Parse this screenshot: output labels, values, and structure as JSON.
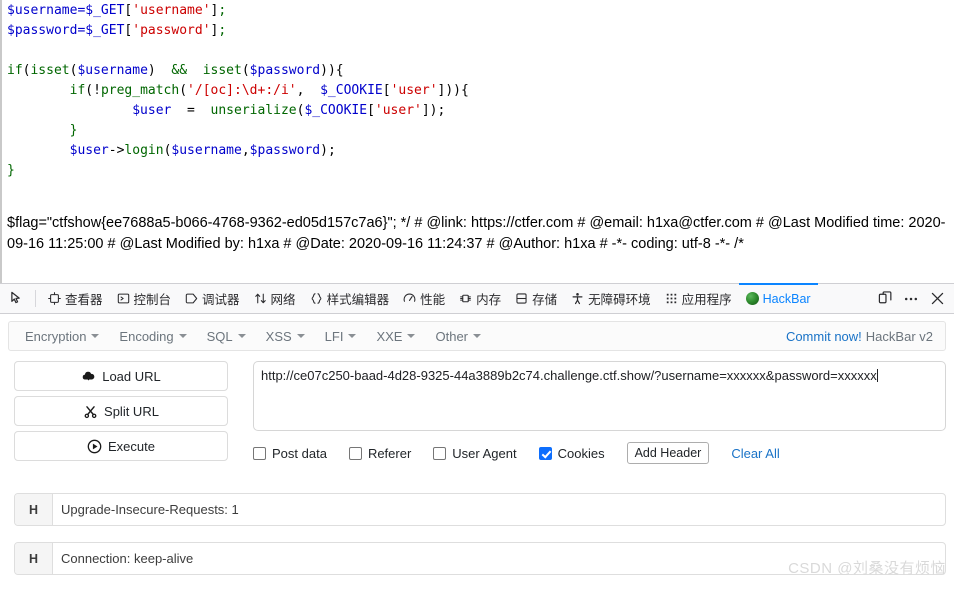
{
  "page": {
    "code_lines": [
      [
        {
          "t": "$username=",
          "c": "var"
        },
        {
          "t": "$_GET",
          "c": "var"
        },
        {
          "t": "[",
          "c": "punc"
        },
        {
          "t": "'username'",
          "c": "str"
        },
        {
          "t": "]",
          "c": "punc"
        },
        {
          "t": ";",
          "c": "fn"
        }
      ],
      [
        {
          "t": "$password=",
          "c": "var"
        },
        {
          "t": "$_GET",
          "c": "var"
        },
        {
          "t": "[",
          "c": "punc"
        },
        {
          "t": "'password'",
          "c": "str"
        },
        {
          "t": "]",
          "c": "punc"
        },
        {
          "t": ";",
          "c": "fn"
        }
      ],
      [],
      [
        {
          "t": "if",
          "c": "kw"
        },
        {
          "t": "(",
          "c": "punc"
        },
        {
          "t": "isset",
          "c": "fn"
        },
        {
          "t": "(",
          "c": "punc"
        },
        {
          "t": "$username",
          "c": "var"
        },
        {
          "t": ")",
          "c": "punc"
        },
        {
          "t": "  &&  ",
          "c": "fn"
        },
        {
          "t": "isset",
          "c": "fn"
        },
        {
          "t": "(",
          "c": "punc"
        },
        {
          "t": "$password",
          "c": "var"
        },
        {
          "t": ")",
          "c": "punc"
        },
        {
          "t": "){",
          "c": "punc"
        }
      ],
      [
        {
          "t": "        ",
          "c": "punc"
        },
        {
          "t": "if",
          "c": "kw"
        },
        {
          "t": "(!",
          "c": "punc"
        },
        {
          "t": "preg_match",
          "c": "fn"
        },
        {
          "t": "(",
          "c": "punc"
        },
        {
          "t": "'/[oc]:\\d+:/i'",
          "c": "str"
        },
        {
          "t": ",  ",
          "c": "punc"
        },
        {
          "t": "$_COOKIE",
          "c": "var"
        },
        {
          "t": "[",
          "c": "punc"
        },
        {
          "t": "'user'",
          "c": "str"
        },
        {
          "t": "]",
          "c": "punc"
        },
        {
          "t": ")){",
          "c": "punc"
        }
      ],
      [
        {
          "t": "                ",
          "c": "punc"
        },
        {
          "t": "$user",
          "c": "var"
        },
        {
          "t": "  =  ",
          "c": "punc"
        },
        {
          "t": "unserialize",
          "c": "fn"
        },
        {
          "t": "(",
          "c": "punc"
        },
        {
          "t": "$_COOKIE",
          "c": "var"
        },
        {
          "t": "[",
          "c": "punc"
        },
        {
          "t": "'user'",
          "c": "str"
        },
        {
          "t": "]);",
          "c": "punc"
        }
      ],
      [
        {
          "t": "        }",
          "c": "fn"
        }
      ],
      [
        {
          "t": "        ",
          "c": "punc"
        },
        {
          "t": "$user",
          "c": "var"
        },
        {
          "t": "->",
          "c": "punc"
        },
        {
          "t": "login",
          "c": "fn"
        },
        {
          "t": "(",
          "c": "punc"
        },
        {
          "t": "$username",
          "c": "var"
        },
        {
          "t": ",",
          "c": "punc"
        },
        {
          "t": "$password",
          "c": "var"
        },
        {
          "t": ");",
          "c": "punc"
        }
      ],
      [
        {
          "t": "}",
          "c": "fn"
        }
      ]
    ],
    "flag_text": "$flag=\"ctfshow{ee7688a5-b066-4768-9362-ed05d157c7a6}\"; */ # @link: https://ctfer.com # @email: h1xa@ctfer.com # @Last Modified time: 2020-09-16 11:25:00 # @Last Modified by: h1xa # @Date: 2020-09-16 11:24:37 # @Author: h1xa # -*- coding: utf-8 -*- /*"
  },
  "devtools": {
    "tabs": [
      {
        "label": "查看器",
        "icon": "inspector-icon",
        "active": false
      },
      {
        "label": "控制台",
        "icon": "console-icon",
        "active": false
      },
      {
        "label": "调试器",
        "icon": "debugger-icon",
        "active": false
      },
      {
        "label": "网络",
        "icon": "network-icon",
        "active": false
      },
      {
        "label": "样式编辑器",
        "icon": "style-editor-icon",
        "active": false
      },
      {
        "label": "性能",
        "icon": "performance-icon",
        "active": false
      },
      {
        "label": "内存",
        "icon": "memory-icon",
        "active": false
      },
      {
        "label": "存储",
        "icon": "storage-icon",
        "active": false
      },
      {
        "label": "无障碍环境",
        "icon": "accessibility-icon",
        "active": false
      },
      {
        "label": "应用程序",
        "icon": "application-icon",
        "active": false
      },
      {
        "label": "HackBar",
        "icon": "hackbar-icon",
        "active": true
      }
    ],
    "picker_icon": "element-picker-icon",
    "dock_icon": "dock-layout-icon",
    "meatball_icon": "more-options-icon",
    "close_icon": "close-icon",
    "active_color": "#0a84ff"
  },
  "hackbar": {
    "menus": [
      {
        "label": "Encryption"
      },
      {
        "label": "Encoding"
      },
      {
        "label": "SQL"
      },
      {
        "label": "XSS"
      },
      {
        "label": "LFI"
      },
      {
        "label": "XXE"
      },
      {
        "label": "Other"
      }
    ],
    "commit_label": "Commit now!",
    "version_label": "HackBar v2",
    "buttons": [
      {
        "label": "Load URL",
        "icon": "cloud-download-icon"
      },
      {
        "label": "Split URL",
        "icon": "scissors-icon"
      },
      {
        "label": "Execute",
        "icon": "play-circle-icon"
      }
    ],
    "url_value": "http://ce07c250-baad-4d28-9325-44a3889b2c74.challenge.ctf.show/?username=xxxxxx&password=xxxxxx",
    "url_placeholder": "",
    "checkboxes": [
      {
        "label": "Post data",
        "checked": false
      },
      {
        "label": "Referer",
        "checked": false
      },
      {
        "label": "User Agent",
        "checked": false
      },
      {
        "label": "Cookies",
        "checked": true
      }
    ],
    "add_header_label": "Add Header",
    "clear_all_label": "Clear All",
    "header_prefix": "H",
    "headers": [
      {
        "value": "Upgrade-Insecure-Requests: 1"
      },
      {
        "value": "Connection: keep-alive"
      }
    ],
    "accent_color": "#0d6efd",
    "link_color": "#1a73c7"
  },
  "watermark": {
    "text": "CSDN @刘桑没有烦恼"
  }
}
